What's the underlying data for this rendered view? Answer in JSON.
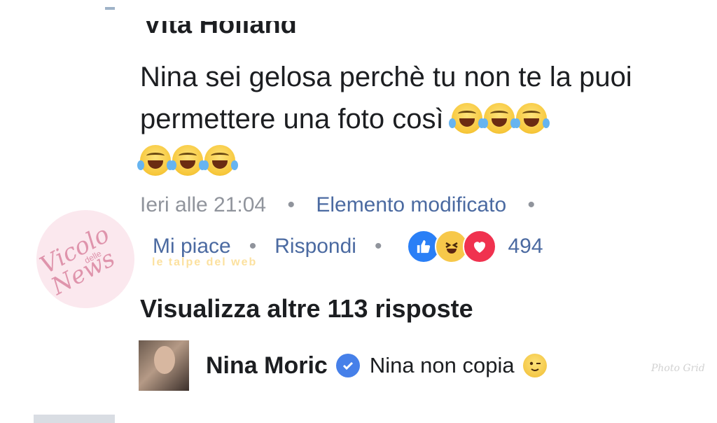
{
  "top_comment": {
    "author_cut": "Vita Holland",
    "text": "Nina sei gelosa perchè tu non te la puoi permettere una foto così",
    "emoji_line1_count": 3,
    "emoji_line2_count": 3,
    "timestamp": "Ieri alle 21:04",
    "edited_label": "Elemento modificato",
    "separator": "•",
    "like_label": "Mi piace",
    "reply_label": "Rispondi",
    "reactions": [
      "like-icon",
      "haha-icon",
      "love-icon"
    ],
    "reaction_count": "494"
  },
  "view_more": "Visualizza altre 113 risposte",
  "reply": {
    "author": "Nina Moric",
    "text": "Nina non copia"
  },
  "watermarks": {
    "left_main": "Vicolo News",
    "left_small": "delle",
    "center": "le talpe del web",
    "right": "Photo Grid"
  },
  "colors": {
    "text": "#1c1e21",
    "muted": "#90949c",
    "link": "#4b6aa1",
    "like": "#2a7ff6",
    "haha": "#f7c84a",
    "love": "#f0324f",
    "verified": "#4680e9"
  }
}
